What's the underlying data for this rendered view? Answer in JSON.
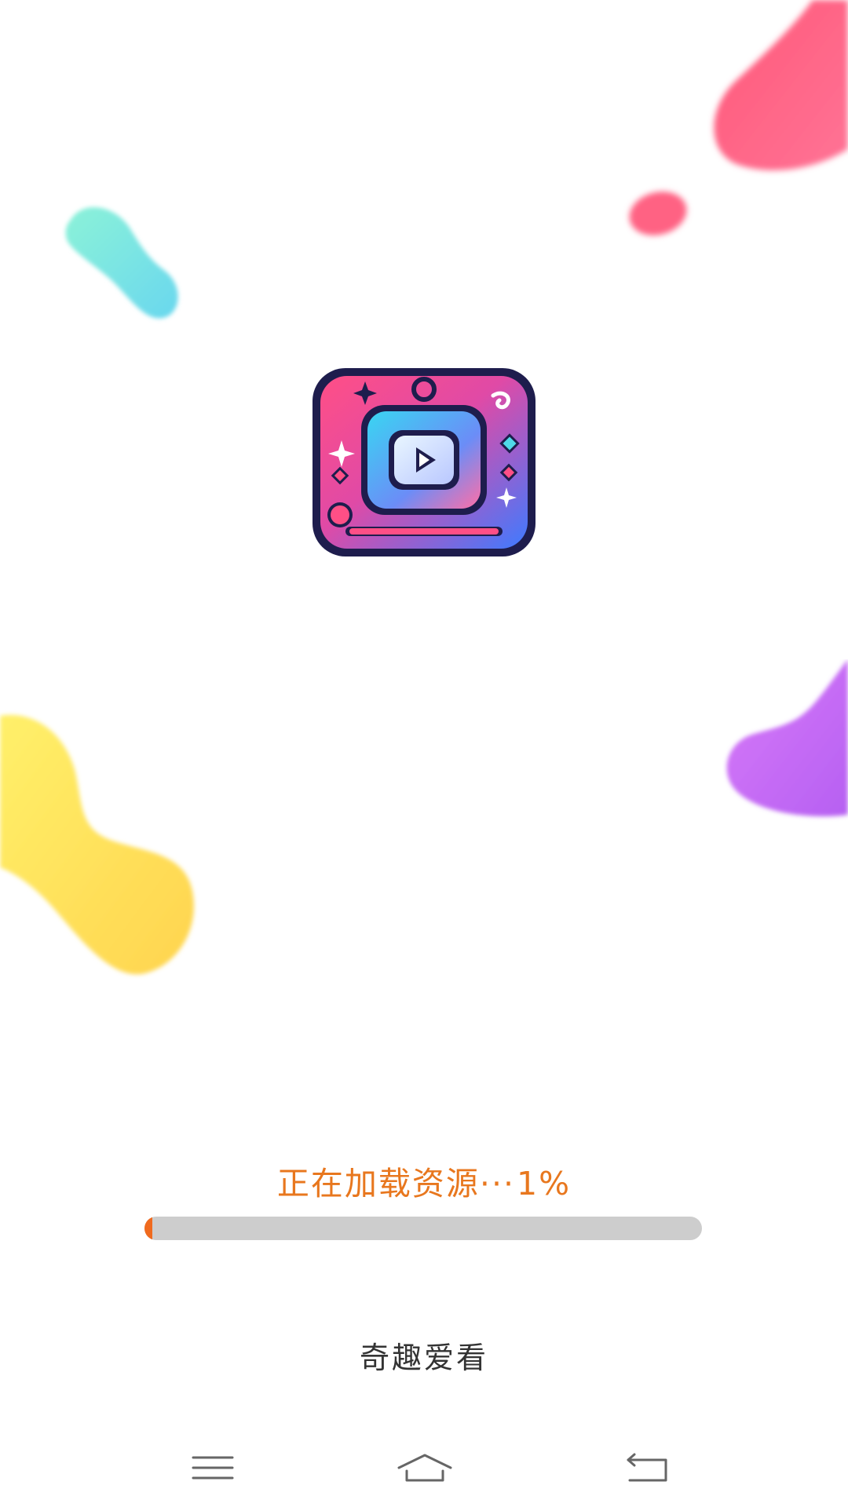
{
  "loading": {
    "label": "正在加载资源···",
    "percent_text": "1%",
    "progress": 0.01,
    "accent_color": "#e8771e",
    "bar_fill_color": "#f06a1e",
    "bar_track_color": "#cdcdcd"
  },
  "app": {
    "name": "奇趣爱看",
    "logo_icon": "tv-play-icon"
  },
  "nav_bar": {
    "buttons": [
      {
        "icon": "menu-icon"
      },
      {
        "icon": "home-icon"
      },
      {
        "icon": "back-icon"
      }
    ]
  },
  "decor_colors": {
    "teal": "#7de6dc",
    "pink": "#ff5f86",
    "yellow": "#ffe15e",
    "purple": "#c66cf5"
  }
}
